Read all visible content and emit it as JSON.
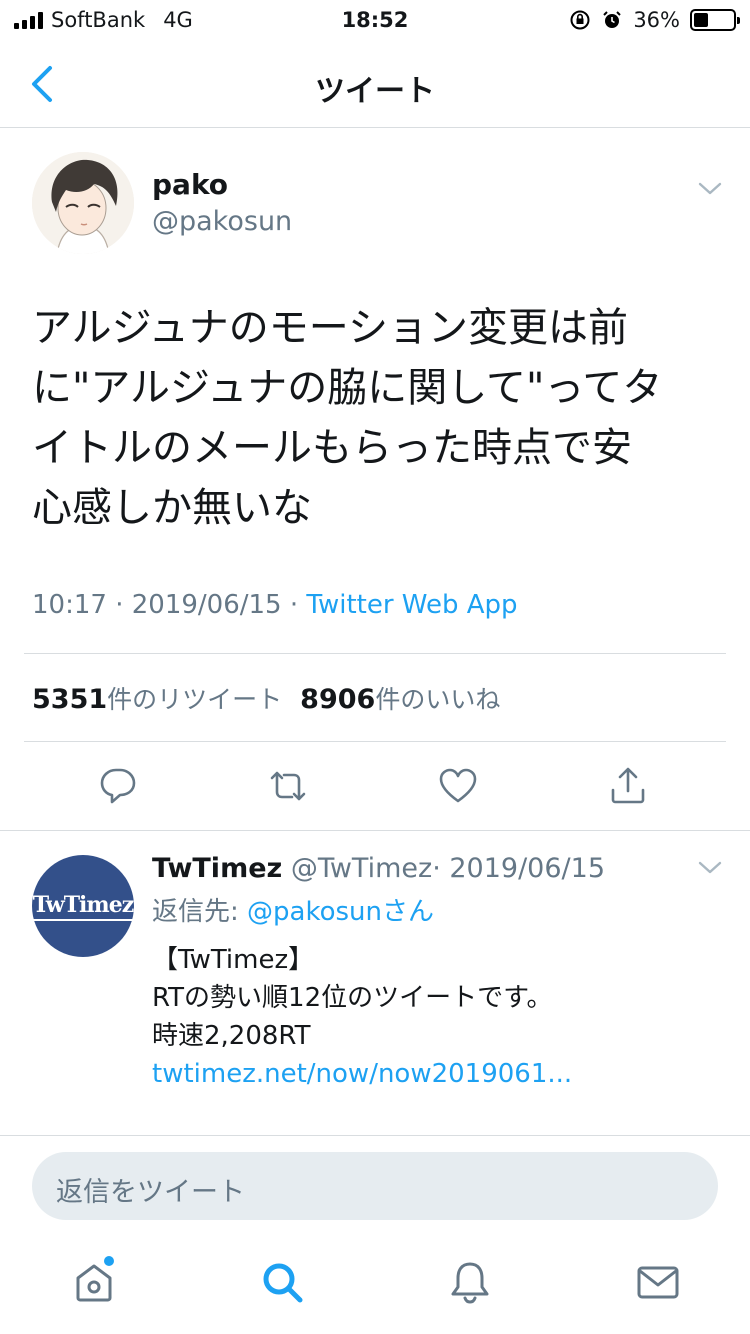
{
  "status_bar": {
    "carrier": "SoftBank",
    "network": "4G",
    "time": "18:52",
    "battery": "36%",
    "battery_level": 0.36
  },
  "nav": {
    "title": "ツイート"
  },
  "tweet": {
    "author_name": "pako",
    "author_handle": "@pakosun",
    "lines": [
      "アルジュナのモーション変更は前",
      "に\"アルジュナの脇に関して\"ってタ",
      "イトルのメールもらった時点で安",
      "心感しか無いな"
    ],
    "time": "10:17",
    "date": "2019/06/15",
    "separator": "·",
    "source": "Twitter Web App",
    "retweet_count": "5351",
    "retweet_label": "件のリツイート",
    "like_count": "8906",
    "like_label": "件のいいね"
  },
  "reply": {
    "avatar_text": "TwTimez",
    "author_name": "TwTimez",
    "author_handle": "@TwTimez",
    "separator": "·",
    "date": "2019/06/15",
    "reply_prefix": "返信先: ",
    "reply_to": "@pakosunさん",
    "body_lines": [
      "【TwTimez】",
      "RTの勢い順12位のツイートです。",
      "時速2,208RT"
    ],
    "link": "twtimez.net/now/now2019061..."
  },
  "compose": {
    "placeholder": "返信をツイート"
  },
  "colors": {
    "accent": "#1da1f2",
    "muted": "#657786",
    "text": "#14171a",
    "border": "#d9dde0"
  },
  "icons": {
    "back": "chevron-left-icon",
    "more": "chevron-down-icon",
    "reply": "comment-icon",
    "retweet": "retweet-icon",
    "like": "heart-icon",
    "share": "share-icon",
    "home": "home-icon",
    "search": "search-icon",
    "notifications": "bell-icon",
    "messages": "mail-icon"
  }
}
